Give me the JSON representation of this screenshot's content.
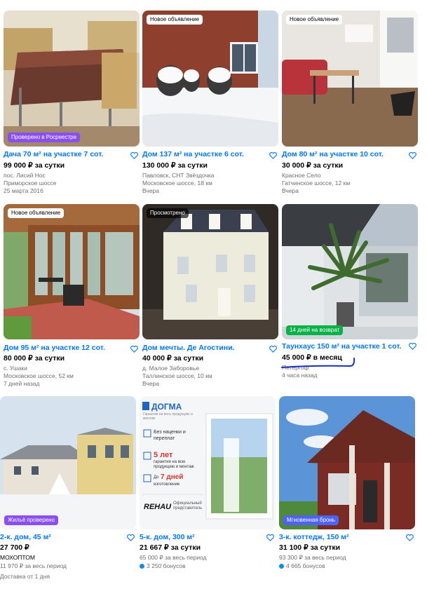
{
  "cards": [
    {
      "title": "Дача 70 м² на участке 7 сот.",
      "price": "99 000 ₽ за сутки",
      "lines": [
        "пос. Лисий Нос",
        "Приморское шоссе",
        "25 марта 2016"
      ],
      "badge_bottom": "Проверено в Росреестре"
    },
    {
      "title": "Дом 137 м² на участке 6 сот.",
      "price": "130 000 ₽ за сутки",
      "lines": [
        "Павловск, СНТ Звёздочка",
        "Московское шоссе, 18 км",
        "Вчера"
      ],
      "badge_top": "Новое объявление"
    },
    {
      "title": "Дом 80 м² на участке 10 сот.",
      "price": "30 000 ₽ за сутки",
      "lines": [
        "Красное Село",
        "Гатчинское шоссе, 12 км",
        "Вчера"
      ],
      "badge_top": "Новое объявление"
    },
    {
      "title": "Дом 95 м² на участке 12 сот.",
      "price": "80 000 ₽ за сутки",
      "lines": [
        "с. Ушаки",
        "Московское шоссе, 52 км",
        "7 дней назад"
      ],
      "badge_top": "Новое объявление"
    },
    {
      "title": "Дом мечты. Де Агостини.",
      "price": "40 000 ₽ за сутки",
      "lines": [
        "д. Малое Заборовье",
        "Таллинское шоссе, 10 км",
        "Вчера"
      ],
      "badge_top": "Просмотрено"
    },
    {
      "title": "Таунхаус 150 м² на участке 1 сот.",
      "price": "45 000 ₽ в месяц",
      "lines": [
        "Петергоф",
        "4 часа назад"
      ],
      "badge_bottom": "14 дней на возврат"
    },
    {
      "title": "2-к. дом, 45 м²",
      "price": "27 700 ₽",
      "lines": [
        "МОХОПТОМ",
        "11 970 ₽ за весь период",
        "Доставка от 1 дня"
      ],
      "badge_bottom": "Жильё проверено"
    },
    {
      "title": "5-к. дом, 300 м²",
      "price": "21 667 ₽ за сутки",
      "lines": [
        "65 000 ₽ за весь период",
        "3 250 бонусов"
      ],
      "ad": {
        "brand": "ДОГМА",
        "tagline": "Гарантия на весь продукцию и монтаж",
        "feature1": "Без наценки и переплат",
        "feature2_big": "5 лет",
        "feature2": "гарантия на всю продукцию и монтаж",
        "feature3_prefix": "До",
        "feature3_big": "7 дней",
        "feature3": "изготовление",
        "partner": "REHAU",
        "partner_sub": "Официальный представитель"
      }
    },
    {
      "title": "3-к. коттедж, 150 м²",
      "price": "31 100 ₽ за сутки",
      "lines": [
        "93 300 ₽ за весь период",
        "4 665 бонусов"
      ],
      "badge_bottom": "Мгновенная бронь"
    }
  ],
  "colors": {
    "link": "#0077ff",
    "badge_purple": "#8a4ff0",
    "badge_green": "#07b246",
    "badge_blue": "#4d63f7",
    "bonus": "#0a8cf0"
  }
}
